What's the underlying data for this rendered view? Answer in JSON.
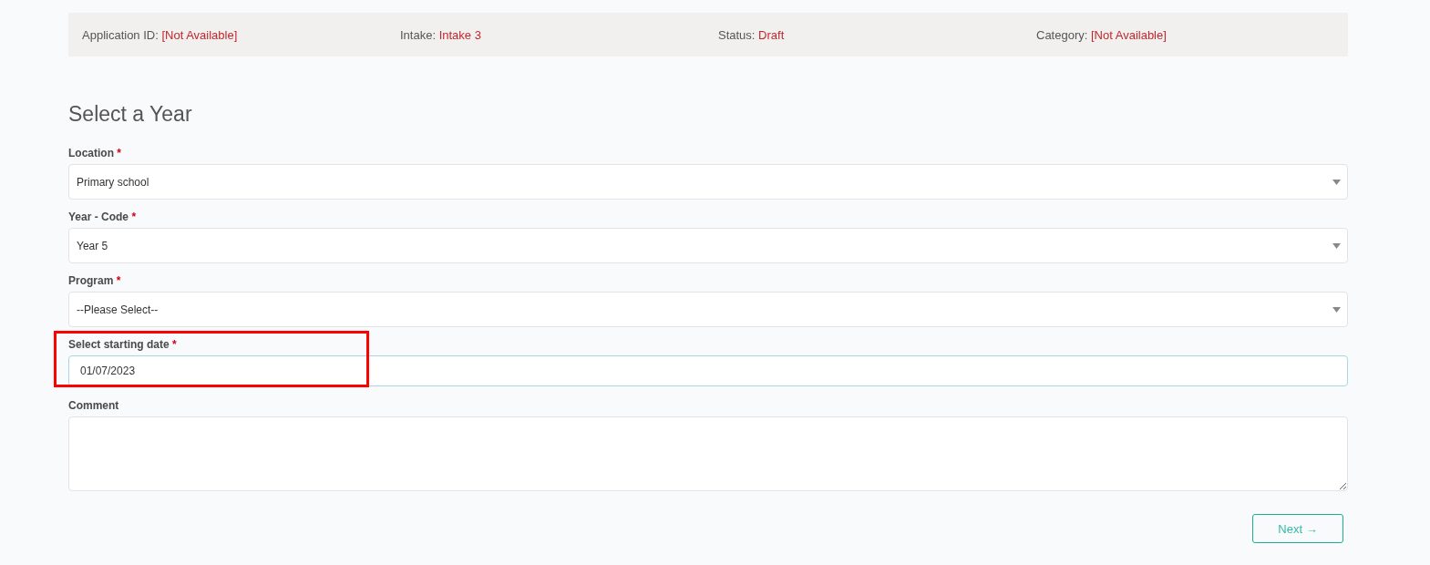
{
  "info_bar": [
    {
      "label": "Application ID:",
      "value": "[Not Available]"
    },
    {
      "label": "Intake:",
      "value": "Intake 3"
    },
    {
      "label": "Status:",
      "value": "Draft"
    },
    {
      "label": "Category:",
      "value": "[Not Available]"
    }
  ],
  "heading": "Select a Year",
  "fields": [
    {
      "kind": "select",
      "label": "Location",
      "required_mark": "*",
      "value": "Primary school"
    },
    {
      "kind": "select",
      "label": "Year - Code",
      "required_mark": "*",
      "value": "Year 5"
    },
    {
      "kind": "select",
      "label": "Program",
      "required_mark": "*",
      "value": "--Please Select--"
    },
    {
      "kind": "date",
      "label": "Select starting date",
      "required_mark": "*",
      "value": "01/07/2023",
      "highlighted": true
    },
    {
      "kind": "textarea",
      "label": "Comment"
    }
  ],
  "next_button": "Next →"
}
